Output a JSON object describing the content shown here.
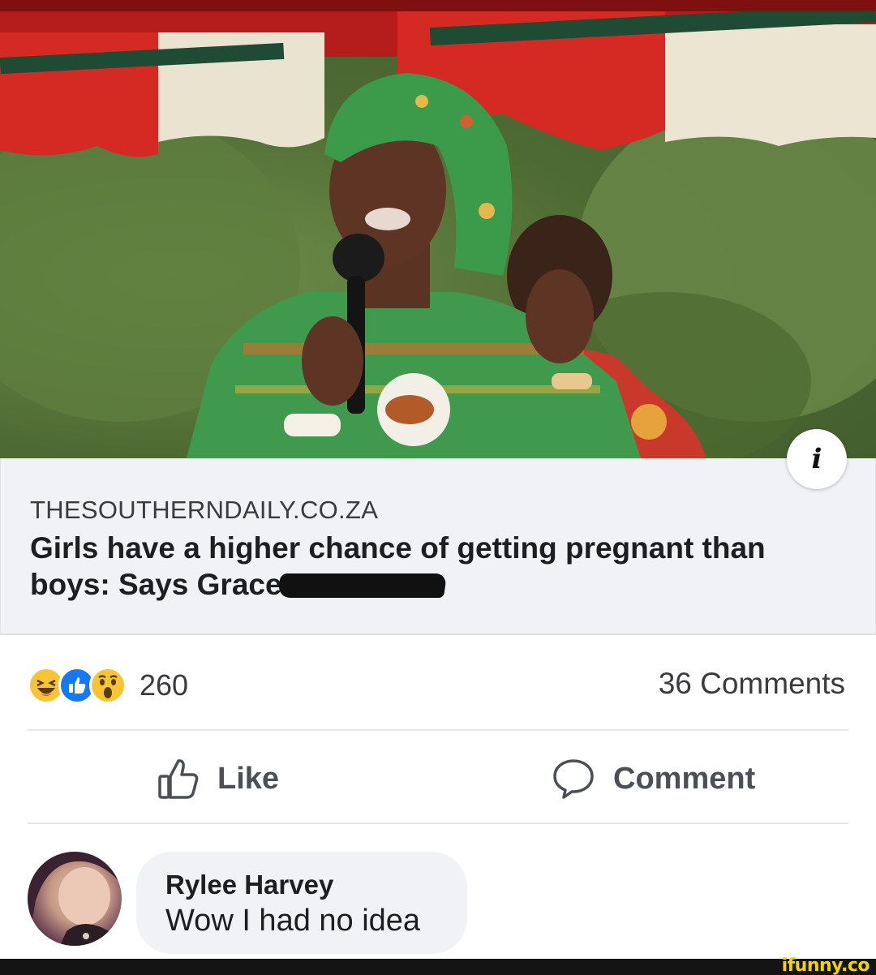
{
  "post": {
    "link_preview": {
      "domain": "THESOUTHERNDAILY.CO.ZA",
      "headline": "Girls have a higher chance of getting pregnant than boys: Says Grace",
      "info_icon": "info-icon"
    },
    "reactions": {
      "icons": [
        "haha-icon",
        "like-icon",
        "wow-icon"
      ],
      "count": "260"
    },
    "comments_count": "36 Comments",
    "actions": {
      "like_label": "Like",
      "comment_label": "Comment"
    }
  },
  "comment": {
    "author": "Rylee Harvey",
    "text": "Wow I had no idea"
  },
  "watermark": "ifunny.co",
  "colors": {
    "preview_bg": "#f0f2f5",
    "like_blue": "#1877f2",
    "reaction_yellow": "#f7c533",
    "watermark_yellow": "#f5d300"
  }
}
